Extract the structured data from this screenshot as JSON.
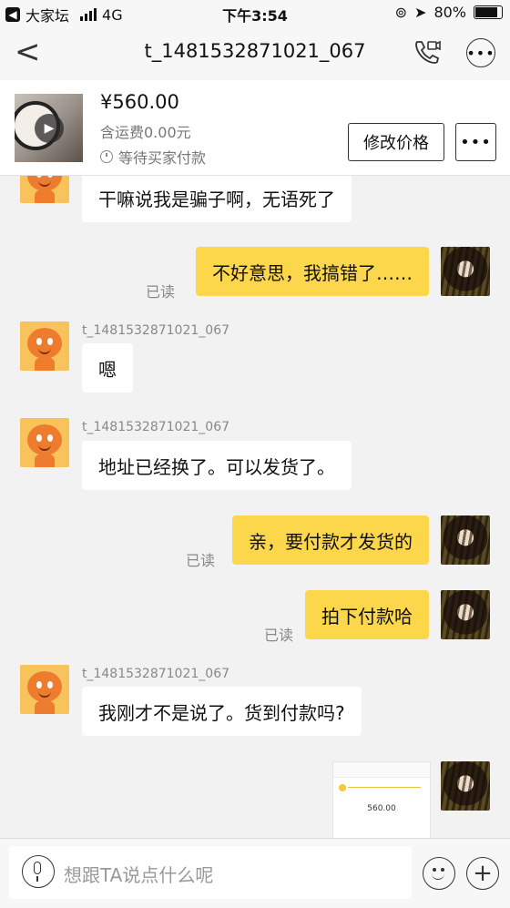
{
  "status_bar": {
    "back_app": "大家坛",
    "network": "4G",
    "time": "下午3:54",
    "battery": "80%"
  },
  "header": {
    "title": "t_1481532871021_067"
  },
  "product": {
    "price": "¥560.00",
    "shipping": "含运费0.00元",
    "status": "等待买家付款",
    "edit_price_label": "修改价格",
    "more_label": "•••"
  },
  "messages": [
    {
      "from": "seller",
      "text": "干嘛说我是骗子啊，无语死了"
    },
    {
      "from": "me",
      "text": "不好意思，我搞错了……",
      "read": "已读"
    },
    {
      "from": "seller",
      "sender": "t_1481532871021_067",
      "text": "嗯"
    },
    {
      "from": "seller",
      "sender": "t_1481532871021_067",
      "text": "地址已经换了。可以发货了。"
    },
    {
      "from": "me",
      "text": "亲，要付款才发货的",
      "read": "已读"
    },
    {
      "from": "me",
      "text": "拍下付款哈",
      "read": "已读"
    },
    {
      "from": "seller",
      "sender": "t_1481532871021_067",
      "text": "我刚才不是说了。货到付款吗?"
    },
    {
      "from": "me",
      "type": "image",
      "image_amount": "560.00"
    }
  ],
  "input": {
    "placeholder": "想跟TA说点什么呢"
  },
  "colors": {
    "my_bubble": "#fcd64b",
    "their_bubble": "#ffffff",
    "background": "#f2f2f2"
  }
}
